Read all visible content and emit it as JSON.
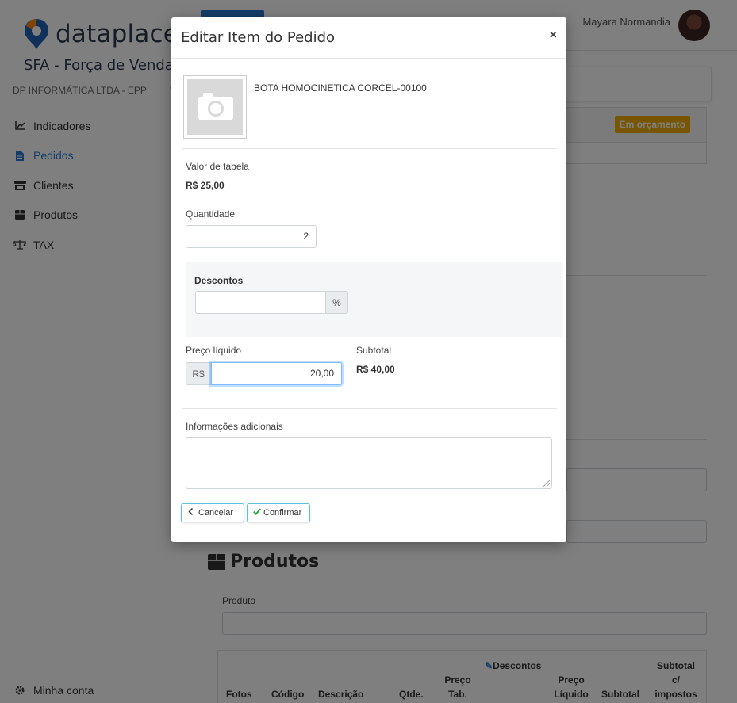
{
  "sidebar": {
    "logo_text": "dataplace",
    "app_subtitle": "SFA - Força de Vendas",
    "company": "DP INFORMÁTICA LTDA - EPP",
    "items": [
      {
        "label": "Indicadores",
        "icon": "chart-line-icon"
      },
      {
        "label": "Pedidos",
        "icon": "file-icon"
      },
      {
        "label": "Clientes",
        "icon": "store-icon"
      },
      {
        "label": "Produtos",
        "icon": "box-icon"
      },
      {
        "label": "TAX",
        "icon": "balance-scale-icon"
      }
    ],
    "account_label": "Minha conta"
  },
  "topbar": {
    "username": "Mayara Normandia"
  },
  "order": {
    "status_badge": "Em orçamento"
  },
  "products_section": {
    "title": "Produtos",
    "product_label": "Produto",
    "columns": [
      "Fotos",
      "Código",
      "Descrição",
      "Qtde.",
      "Preço Tab.",
      "Descontos",
      "Preço Líquido",
      "Subtotal",
      "Subtotal c/ impostos"
    ]
  },
  "modal": {
    "title": "Editar Item do Pedido",
    "close": "×",
    "product_name": "BOTA HOMOCINETICA CORCEL-00100",
    "table_value_label": "Valor de tabela",
    "table_value": "R$ 25,00",
    "quantity_label": "Quantidade",
    "quantity_value": "2",
    "discounts_label": "Descontos",
    "discount_value": "",
    "discount_suffix": "%",
    "net_price_label": "Preço líquido",
    "currency_prefix": "R$",
    "net_price_value": "20,00",
    "subtotal_label": "Subtotal",
    "subtotal_value": "R$ 40,00",
    "additional_info_label": "Informações adicionais",
    "additional_info_value": "",
    "cancel_label": "Cancelar",
    "confirm_label": "Confirmar"
  },
  "colors": {
    "accent": "#2a7bd0",
    "badge": "#f0ad00",
    "button_border": "#5bc0de",
    "confirm_icon": "#28a745"
  }
}
